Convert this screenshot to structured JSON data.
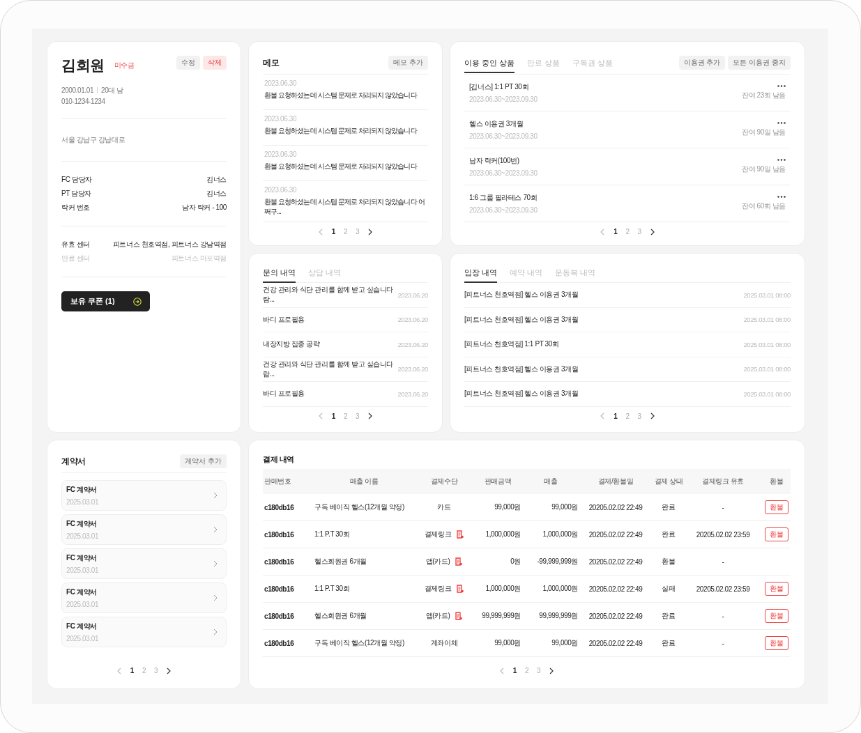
{
  "member": {
    "name": "김회원",
    "badge": "미수금",
    "actions": [
      {
        "label": "수정",
        "kind": "neutral"
      },
      {
        "label": "삭제",
        "kind": "danger"
      }
    ],
    "birth": "2000.01.01",
    "age_gender": "20대 남",
    "phone": "010-1234-1234",
    "address": "서울 강남구 강남대로",
    "staff": [
      {
        "label": "FC 담당자",
        "value": "김너스"
      },
      {
        "label": "PT 담당자",
        "value": "김너스"
      },
      {
        "label": "락커 번호",
        "value": "남자 락커 - 100"
      }
    ],
    "centers": [
      {
        "label": "유효 센터",
        "value": "피트너스 천호역점, 피트너스 강남역점",
        "active": true
      },
      {
        "label": "만료 센터",
        "value": "피트너스 마포역점",
        "active": false
      }
    ],
    "coupon_button": "보유 쿠폰 (1)"
  },
  "memo": {
    "title": "메모",
    "add_button": "메모 추가",
    "items": [
      {
        "date": "2023.06.30",
        "text": "환불 요청하셨는데 시스템 문제로 처리되지 않았습니다"
      },
      {
        "date": "2023.06.30",
        "text": "환불 요청하셨는데 시스템 문제로 처리되지 않았습니다"
      },
      {
        "date": "2023.06.30",
        "text": "환불 요청하셨는데 시스템 문제로 처리되지 않았습니다"
      },
      {
        "date": "2023.06.30",
        "text": "환불 요청하셨는데 시스템 문제로 처리되지 않았습니다 어쩌구..."
      }
    ],
    "pagination": [
      {
        "label": "1",
        "selected": true
      },
      {
        "label": "2",
        "selected": false
      },
      {
        "label": "3",
        "selected": false
      }
    ]
  },
  "products": {
    "tabs": [
      {
        "label": "이용 중인 상품",
        "selected": true
      },
      {
        "label": "만료 상품",
        "selected": false
      },
      {
        "label": "구독권 상품",
        "selected": false
      }
    ],
    "buttons": [
      "이용권 추가",
      "모든 이용권 중지"
    ],
    "items": [
      {
        "name": "[김너스] 1:1 PT 30회",
        "period": "2023.06.30~2023.09.30",
        "remaining": "잔여 23회 남음"
      },
      {
        "name": "헬스 이용권 3개월",
        "period": "2023.06.30~2023.09.30",
        "remaining": "잔여 90일 남음"
      },
      {
        "name": "남자 락커(100번)",
        "period": "2023.06.30~2023.09.30",
        "remaining": "잔여 90일 남음"
      },
      {
        "name": "1:6 그룹 필라테스 70회",
        "period": "2023.06.30~2023.09.30",
        "remaining": "잔여 60회 남음"
      }
    ],
    "pagination": [
      {
        "label": "1",
        "selected": true
      },
      {
        "label": "2",
        "selected": false
      },
      {
        "label": "3",
        "selected": false
      }
    ]
  },
  "inquiries": {
    "tabs": [
      {
        "label": "문의 내역",
        "selected": true
      },
      {
        "label": "상담 내역",
        "selected": false
      }
    ],
    "items": [
      {
        "title": "건강 관리와 식단 관리를 함께 받고 싶습니다람...",
        "date": "2023.06.20"
      },
      {
        "title": "바디 프로필용",
        "date": "2023.06.20"
      },
      {
        "title": "내장지방 집중 공략",
        "date": "2023.06.20"
      },
      {
        "title": "건강 관리와 식단 관리를 함께 받고 싶습니다람...",
        "date": "2023.06.20"
      },
      {
        "title": "바디 프로필용",
        "date": "2023.06.20"
      }
    ],
    "pagination": [
      {
        "label": "1",
        "selected": true
      },
      {
        "label": "2",
        "selected": false
      },
      {
        "label": "3",
        "selected": false
      }
    ]
  },
  "entries": {
    "tabs": [
      {
        "label": "입장 내역",
        "selected": true
      },
      {
        "label": "예약 내역",
        "selected": false
      },
      {
        "label": "운동복 내역",
        "selected": false
      }
    ],
    "items": [
      {
        "title": "[피트너스 천호역점] 헬스 이용권 3개월",
        "datetime": "2025.03.01 08:00"
      },
      {
        "title": "[피트너스 천호역점] 헬스 이용권 3개월",
        "datetime": "2025.03.01 08:00"
      },
      {
        "title": "[피트너스 천호역점] 1:1 PT 30회",
        "datetime": "2025.03.01 08:00"
      },
      {
        "title": "[피트너스 천호역점] 헬스 이용권 3개월",
        "datetime": "2025.03.01 08:00"
      },
      {
        "title": "[피트너스 천호역점] 헬스 이용권 3개월",
        "datetime": "2025.03.01 08:00"
      }
    ],
    "pagination": [
      {
        "label": "1",
        "selected": true
      },
      {
        "label": "2",
        "selected": false
      },
      {
        "label": "3",
        "selected": false
      }
    ]
  },
  "contracts": {
    "title": "계약서",
    "add_button": "계약서 추가",
    "items": [
      {
        "title": "FC 계약서",
        "date": "2025.03.01"
      },
      {
        "title": "FC 계약서",
        "date": "2025.03.01"
      },
      {
        "title": "FC 계약서",
        "date": "2025.03.01"
      },
      {
        "title": "FC 계약서",
        "date": "2025.03.01"
      },
      {
        "title": "FC 계약서",
        "date": "2025.03.01"
      }
    ],
    "pagination": [
      {
        "label": "1",
        "selected": true
      },
      {
        "label": "2",
        "selected": false
      },
      {
        "label": "3",
        "selected": false
      }
    ]
  },
  "payments": {
    "title": "결제 내역",
    "columns": [
      "판매번호",
      "매출 이름",
      "결제수단",
      "판매금액",
      "매출",
      "결제/환불일",
      "결제 상태",
      "결제링크 유효",
      "환불"
    ],
    "rows": [
      {
        "cells": [
          "c180db16",
          "구독 베이직 헬스(12개월 약정)",
          "카드",
          "99,000원",
          "99,000원",
          "20205.02.02 22:49",
          "완료",
          "-"
        ],
        "receipt": false,
        "refund_button": "환불"
      },
      {
        "cells": [
          "c180db16",
          "1:1 P.T 30회",
          "결제링크",
          "1,000,000원",
          "1,000,000원",
          "20205.02.02 22:49",
          "완료",
          "20205.02.02 23:59"
        ],
        "receipt": true,
        "refund_button": "환불"
      },
      {
        "cells": [
          "c180db16",
          "헬스회원권 6개월",
          "앱(카드)",
          "0원",
          "-99,999,999원",
          "20205.02.02 22:49",
          "환불",
          "-"
        ],
        "receipt": true
      },
      {
        "cells": [
          "c180db16",
          "1:1 P.T 30회",
          "결제링크",
          "1,000,000원",
          "1,000,000원",
          "20205.02.02 22:49",
          "실패",
          "20205.02.02 23:59"
        ],
        "receipt": true,
        "refund_button": "환불"
      },
      {
        "cells": [
          "c180db16",
          "헬스회원권 6개월",
          "앱(카드)",
          "99,999,999원",
          "99,999,999원",
          "20205.02.02 22:49",
          "완료",
          "-"
        ],
        "receipt": true,
        "refund_button": "환불"
      },
      {
        "cells": [
          "c180db16",
          "구독 베이직 헬스(12개월 약정)",
          "계좌이체",
          "99,000원",
          "99,000원",
          "20205.02.02 22:49",
          "완료",
          "-"
        ],
        "receipt": false,
        "refund_button": "환불"
      }
    ],
    "pagination": [
      {
        "label": "1",
        "selected": true
      },
      {
        "label": "2",
        "selected": false
      },
      {
        "label": "3",
        "selected": false
      }
    ]
  }
}
